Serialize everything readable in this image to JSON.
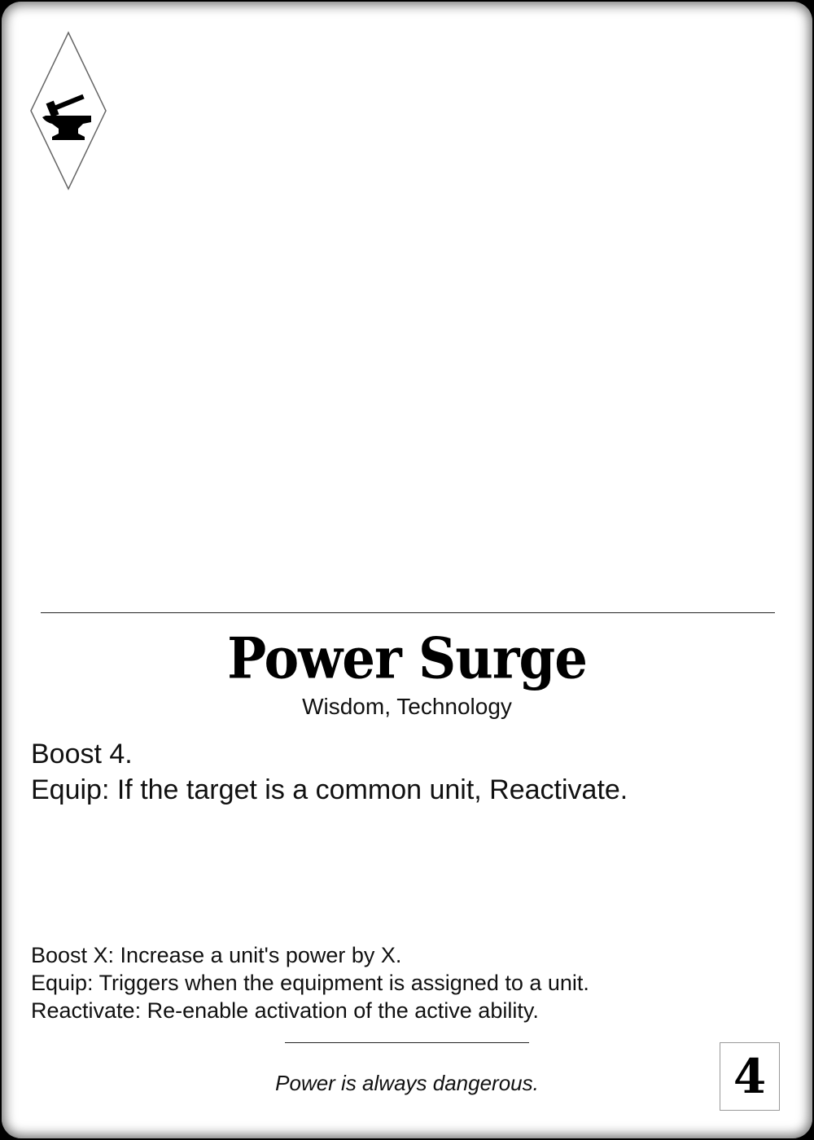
{
  "card": {
    "icon": "anvil-hammer-icon",
    "title": "Power Surge",
    "traits": "Wisdom, Technology",
    "rules": [
      "Boost 4.",
      "Equip: If the target is a common unit, Reactivate."
    ],
    "glossary": [
      "Boost X: Increase a unit's power by X.",
      "Equip: Triggers when the equipment is assigned to a unit.",
      "Reactivate: Re-enable activation of the active ability."
    ],
    "flavor": "Power is always dangerous.",
    "cost": "4"
  },
  "colors": {
    "frame": "#000000",
    "card_background": "#ffffff",
    "text": "#111111"
  }
}
